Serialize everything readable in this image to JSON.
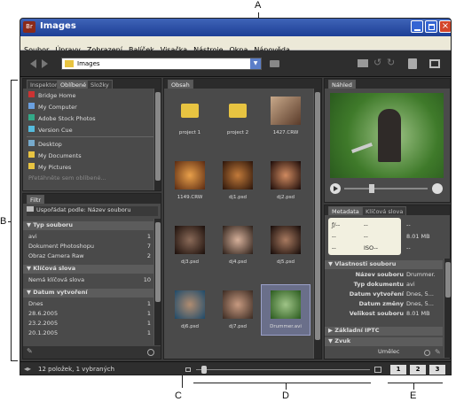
{
  "callouts": {
    "a": "A",
    "b": "B",
    "c": "C",
    "d": "D",
    "e": "E"
  },
  "window": {
    "app_badge": "Br",
    "title": "Images"
  },
  "menu": [
    "Soubor",
    "Úpravy",
    "Zobrazení",
    "Balíček",
    "Visačka",
    "Nástroje",
    "Okna",
    "Nápověda"
  ],
  "toolbar": {
    "path": "Images"
  },
  "left_top": {
    "tabs": [
      "Inspektor",
      "Oblíbené",
      "Složky"
    ],
    "items": [
      "Bridge Home",
      "My Computer",
      "Adobe Stock Photos",
      "Version Cue",
      "Desktop",
      "My Documents",
      "My Pictures"
    ],
    "hint": "Přetáhněte sem oblíbené..."
  },
  "filter": {
    "tab": "Filtr",
    "sort": "Uspořádat podle: Název souboru",
    "groups": [
      {
        "title": "Typ souboru",
        "rows": [
          {
            "l": "avi",
            "c": "1"
          },
          {
            "l": "Dokument Photoshopu",
            "c": "7"
          },
          {
            "l": "Obraz Camera Raw",
            "c": "2"
          }
        ]
      },
      {
        "title": "Klíčová slova",
        "rows": [
          {
            "l": "Nemá klíčová slova",
            "c": "10"
          }
        ]
      },
      {
        "title": "Datum vytvoření",
        "rows": [
          {
            "l": "Dnes",
            "c": "1"
          },
          {
            "l": "28.6.2005",
            "c": "1"
          },
          {
            "l": "23.2.2005",
            "c": "1"
          },
          {
            "l": "20.1.2005",
            "c": "1"
          }
        ]
      }
    ]
  },
  "content": {
    "tab": "Obsah",
    "items": [
      "project 1",
      "project 2",
      "1427.CRW",
      "1149.CRW",
      "dj1.psd",
      "dj2.psd",
      "dj3.psd",
      "dj4.psd",
      "dj5.psd",
      "dj6.psd",
      "dj7.psd",
      "Drummer.avi"
    ]
  },
  "preview": {
    "tab": "Náhled"
  },
  "metadata": {
    "tabs": [
      "Metadata",
      "Klíčová slova"
    ],
    "box": {
      "r1a": "ƒ/--",
      "r1b": "--",
      "r2a": "--",
      "r2b": "--",
      "r3a": "--",
      "r3b": "ISO--",
      "s1": "--",
      "s2": "8.01 MB",
      "s3": "--"
    },
    "section": "Vlastnosti souboru",
    "props": [
      {
        "k": "Název souboru",
        "v": "Drummer."
      },
      {
        "k": "Typ dokumentu",
        "v": "avi"
      },
      {
        "k": "Datum vytvoření",
        "v": "Dnes, 5..."
      },
      {
        "k": "Datum změny",
        "v": "Dnes, 5..."
      },
      {
        "k": "Velikost souboru",
        "v": "8.01 MB"
      }
    ],
    "sec2": "Základní IPTC",
    "sec3": "Zvuk",
    "sub": "Umělec"
  },
  "status": {
    "text": "12 položek, 1 vybraných",
    "views": [
      "1",
      "2",
      "3"
    ]
  }
}
